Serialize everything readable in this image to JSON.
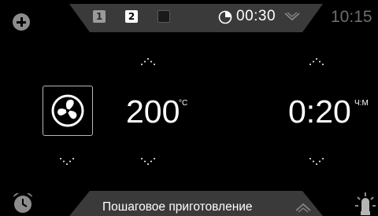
{
  "top_bar": {
    "add_icon": "plus-circle-icon",
    "steps": [
      {
        "label": "1",
        "state": "inactive"
      },
      {
        "label": "2",
        "state": "active"
      },
      {
        "label": "",
        "state": "empty"
      }
    ],
    "timer_icon": "pie-timer-icon",
    "timer_value": "00:30",
    "expand_icon": "chevron-down-icon",
    "clock": "10:15"
  },
  "main": {
    "mode_icon": "fan-icon",
    "temperature": {
      "value": "200",
      "unit": "°C"
    },
    "duration": {
      "value": "0:20",
      "unit": "Ч:М"
    }
  },
  "bottom_bar": {
    "alarm_icon": "alarm-clock-icon",
    "label": "Пошаговое приготовление",
    "collapse_icon": "chevron-up-icon",
    "light_icon": "oven-lamp-icon"
  },
  "colors": {
    "background": "#000000",
    "panel": "#3a3a3a",
    "text": "#ffffff",
    "muted": "#6e6e6e"
  }
}
